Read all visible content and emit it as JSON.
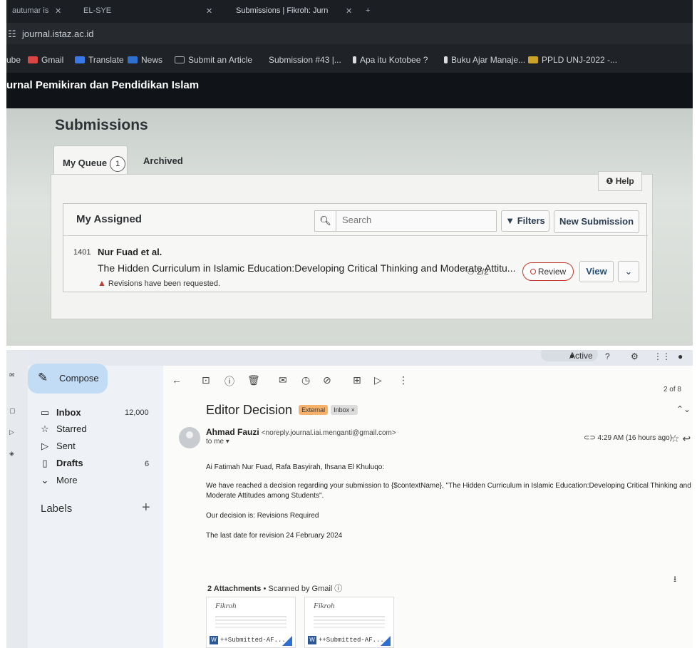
{
  "browser": {
    "tabs": [
      "autumar is",
      "EL-SYE",
      "Submissions | Fikroh: Jurn"
    ],
    "url": "journal.istaz.ac.id",
    "bookmarks": [
      "ube",
      "Gmail",
      "Translate",
      "News",
      "Submit an Article",
      "Submission #43 |...",
      "Apa itu Kotobee ?",
      "Buku Ajar Manaje...",
      "PPLD UNJ-2022 -..."
    ]
  },
  "ojs": {
    "site_title": "urnal Pemikiran dan Pendidikan Islam",
    "page_title": "Submissions",
    "tab_queue": "My Queue",
    "queue_count": "1",
    "tab_archived": "Archived",
    "help": "Help",
    "list_title": "My Assigned",
    "search_placeholder": "Search",
    "filters": "Filters",
    "new_submission": "New Submission",
    "submission": {
      "id": "1401",
      "authors": "Nur Fuad et al.",
      "title": "The Hidden Curriculum in Islamic Education:Developing Critical Thinking and Moderate Attitu...",
      "status": "Revisions have been requested.",
      "participants": "2/2",
      "stage": "Review",
      "view": "View"
    }
  },
  "gmail": {
    "status": "Active",
    "compose": "Compose",
    "nav": [
      {
        "label": "Inbox",
        "count": "12,000"
      },
      {
        "label": "Starred",
        "count": ""
      },
      {
        "label": "Sent",
        "count": ""
      },
      {
        "label": "Drafts",
        "count": "6"
      },
      {
        "label": "More",
        "count": ""
      }
    ],
    "labels": "Labels",
    "page_count": "2 of 8",
    "subject": "Editor Decision",
    "tag_external": "External",
    "tag_inbox": "Inbox ×",
    "sender_name": "Ahmad Fauzi",
    "sender_email": "<noreply.journal.iai.menganti@gmail.com>",
    "to": "to me ▾",
    "time": "4:29 AM (16 hours ago)",
    "greeting": "Ai Fatimah Nur Fuad, Rafa Basyirah, Ihsana El Khuluqo:",
    "paragraph1": "We have reached a decision regarding your submission to {$contextName}, \"The Hidden Curriculum in Islamic Education:Developing Critical Thinking and Moderate Attitudes among Students\".",
    "decision": "Our decision is: Revisions Required",
    "deadline": "The last date for revision 24 February 2024",
    "attachments_title": "2 Attachments",
    "attachments_scanned": "• Scanned by Gmail ⓘ",
    "attachments": [
      {
        "name": "++Submitted-AF..."
      },
      {
        "name": "++Submitted-AF..."
      }
    ],
    "thumb_logo": "Fikroh"
  }
}
